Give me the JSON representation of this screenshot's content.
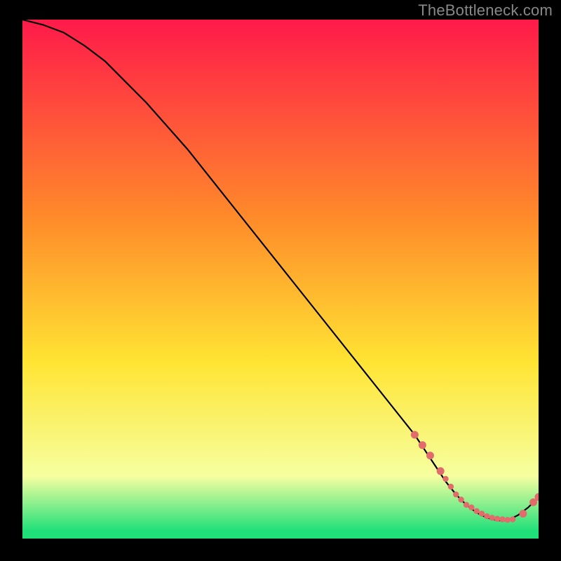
{
  "watermark": "TheBottleneck.com",
  "colors": {
    "bg": "#000000",
    "grad_top": "#ff1a4a",
    "grad_mid1": "#ff8a2a",
    "grad_mid2": "#ffe433",
    "grad_low": "#f6ffa0",
    "grad_green": "#20e07a",
    "curve": "#000000",
    "dot": "#e26b6b"
  },
  "chart_data": {
    "type": "line",
    "title": "",
    "xlabel": "",
    "ylabel": "",
    "xlim": [
      0,
      100
    ],
    "ylim": [
      0,
      100
    ],
    "series": [
      {
        "name": "bottleneck-curve",
        "x": [
          0,
          4,
          8,
          12,
          16,
          20,
          24,
          28,
          32,
          36,
          40,
          44,
          48,
          52,
          56,
          60,
          64,
          68,
          72,
          76,
          78,
          80,
          82,
          84,
          86,
          88,
          90,
          92,
          94,
          96,
          98,
          100
        ],
        "y": [
          100,
          99,
          97.5,
          95,
          92,
          88,
          84,
          79.5,
          75,
          70,
          65,
          60,
          55,
          50,
          45,
          40,
          35,
          30,
          25,
          20,
          17,
          14,
          11,
          8.5,
          6.5,
          5,
          4,
          3.5,
          3.5,
          4.5,
          6,
          8
        ]
      }
    ],
    "markers": {
      "name": "highlight-dots",
      "x": [
        76,
        77.5,
        79,
        81,
        82,
        83,
        84,
        85,
        86,
        87,
        88,
        89,
        90,
        91,
        92,
        93,
        94,
        95,
        97,
        99,
        100
      ],
      "y": [
        20,
        18,
        16,
        13,
        11.5,
        10,
        8.5,
        7.5,
        6.5,
        6,
        5.3,
        4.8,
        4.3,
        4,
        3.8,
        3.7,
        3.6,
        3.7,
        4.8,
        7,
        8
      ]
    }
  }
}
